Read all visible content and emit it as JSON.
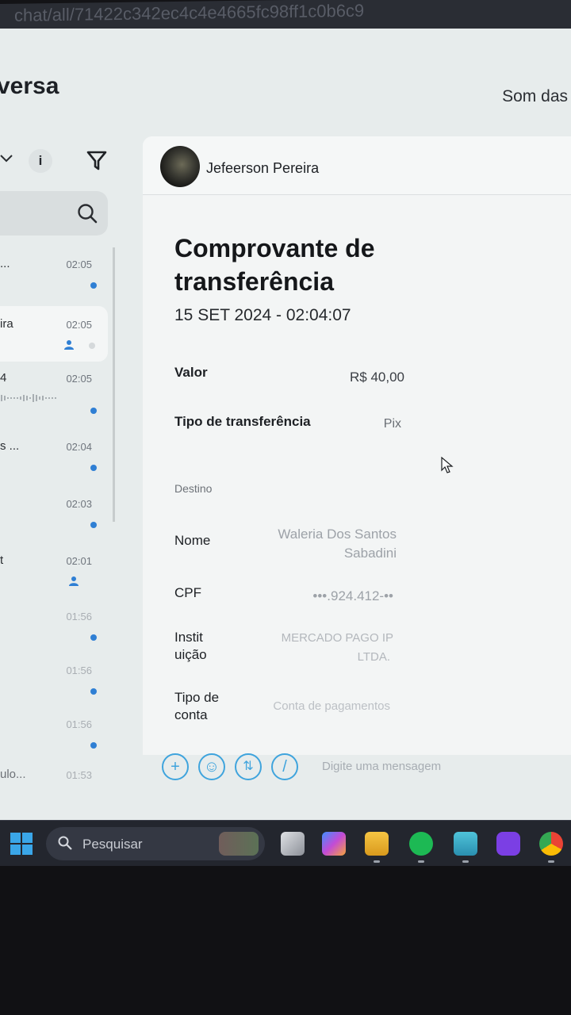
{
  "browser": {
    "url_fragment": "chat/all/71422c342ec4c4e4665fc98ff1c0b6c9"
  },
  "app": {
    "title": "versa",
    "top_right": "Som das"
  },
  "toolbar_left": {
    "info_label": "i"
  },
  "conversations": [
    {
      "name": "...",
      "time": "02:05",
      "status": "unread"
    },
    {
      "name": "ira",
      "time": "02:05",
      "status": "assigned"
    },
    {
      "name": "4",
      "time": "02:05",
      "status": "unread",
      "has_audio": true
    },
    {
      "name": "s ...",
      "time": "02:04",
      "status": "unread"
    },
    {
      "name": "",
      "time": "02:03",
      "status": "unread"
    },
    {
      "name": "t",
      "time": "02:01",
      "status": "assigned"
    },
    {
      "name": "",
      "time": "01:56",
      "status": "unread"
    },
    {
      "name": "",
      "time": "01:56",
      "status": "unread"
    },
    {
      "name": "",
      "time": "01:56",
      "status": "unread"
    },
    {
      "name": "ulo...",
      "time": "01:53",
      "status": "none"
    }
  ],
  "chat": {
    "contact_name": "Jefeerson Pereira",
    "receipt": {
      "title": "Comprovante de transferência",
      "date": "15 SET 2024 - 02:04:07",
      "valor_label": "Valor",
      "valor": "R$ 40,00",
      "tipo_label": "Tipo de transferência",
      "tipo": "Pix",
      "destino_label": "Destino",
      "nome_label": "Nome",
      "nome_line1": "Waleria Dos Santos",
      "nome_line2": "Sabadini",
      "cpf_label": "CPF",
      "cpf": "•••.924.412-••",
      "inst_label_1": "Instit",
      "inst_label_2": "uição",
      "inst_line1": "MERCADO PAGO IP",
      "inst_line2": "LTDA.",
      "conta_label_1": "Tipo de",
      "conta_label_2": "conta",
      "conta": "Conta de pagamentos"
    },
    "input_placeholder": "Digite uma mensagem",
    "tools": [
      "+",
      "☺",
      "⇅",
      "/"
    ]
  },
  "taskbar": {
    "search_label": "Pesquisar",
    "apps": [
      "task-view",
      "copilot",
      "file-explorer",
      "spotify",
      "notepad",
      "app-d",
      "chrome"
    ]
  }
}
